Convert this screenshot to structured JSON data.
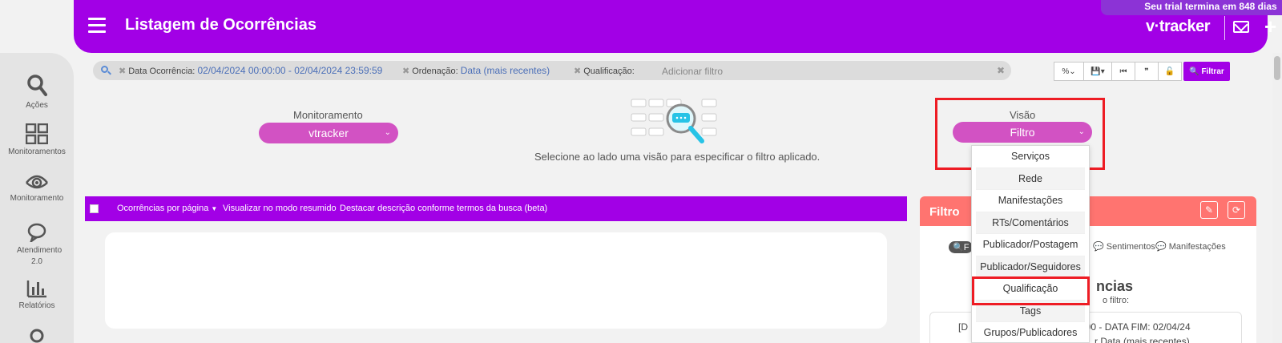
{
  "header": {
    "title": "Listagem de Ocorrências",
    "trial": "Seu trial termina em 848 dias",
    "brand": "v·tracker",
    "brand_color": "#a200e6"
  },
  "sidebar": {
    "items": [
      {
        "label": "Ações",
        "icon": "search-icon"
      },
      {
        "label": "Monitoramentos",
        "icon": "grid-icon"
      },
      {
        "label": "Monitoramento",
        "icon": "eye-icon"
      },
      {
        "label": "Atendimento 2.0",
        "icon": "chat-bubble-icon"
      },
      {
        "label": "Relatórios",
        "icon": "bar-chart-icon"
      }
    ]
  },
  "filterbar": {
    "chips": [
      {
        "key": "Data Ocorrência:",
        "value": "02/04/2024 00:00:00 - 02/04/2024 23:59:59"
      },
      {
        "key": "Ordenação:",
        "value": "Data (mais recentes)"
      },
      {
        "key": "Qualificação:",
        "value": ""
      }
    ],
    "add_placeholder": "Adicionar filtro",
    "filter_button": "Filtrar"
  },
  "monitoramento": {
    "label": "Monitoramento",
    "selected": "vtracker"
  },
  "empty_message": "Selecione ao lado uma visão para especificar o filtro aplicado.",
  "visao": {
    "label": "Visão",
    "selected": "Filtro",
    "options": [
      "Serviços",
      "Rede",
      "Manifestações",
      "RTs/Comentários",
      "Publicador/Postagem",
      "Publicador/Seguidores",
      "Qualificação",
      "Tags",
      "Grupos/Publicadores"
    ]
  },
  "listbar": {
    "items": [
      "Ocorrências por página",
      "Visualizar no modo resumido",
      "Destacar descrição conforme termos da busca (beta)"
    ]
  },
  "right_panel": {
    "title": "Filtro",
    "tabs": [
      "F",
      "Sentimentos",
      "Manifestações"
    ],
    "heading": "ncias",
    "subheading": "o filtro:",
    "line1": "[D",
    "line1b": "00:00 - DATA FIM: 02/04/24",
    "line2": "r Data (mais recentes)"
  }
}
